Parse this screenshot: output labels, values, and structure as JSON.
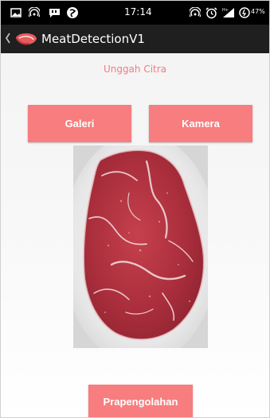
{
  "status_bar": {
    "time": "17:14",
    "battery_percent": "47%",
    "icons": [
      "gallery-icon",
      "hotspot-icon",
      "message-icon",
      "sync-icon",
      "wifi-hotspot-icon",
      "alarm-icon",
      "signal-icon",
      "battery-icon"
    ]
  },
  "action_bar": {
    "title": "MeatDetectionV1",
    "icon": "meat-icon"
  },
  "screen": {
    "heading": "Unggah Citra",
    "buttons": {
      "gallery": "Galeri",
      "camera": "Kamera",
      "preprocess": "Prapengolahan"
    },
    "image_preview": "beef steak photo"
  },
  "colors": {
    "accent": "#f77d7e",
    "heading": "#f27b80",
    "status_bar": "#000000",
    "action_bar": "#1f1f1f"
  }
}
